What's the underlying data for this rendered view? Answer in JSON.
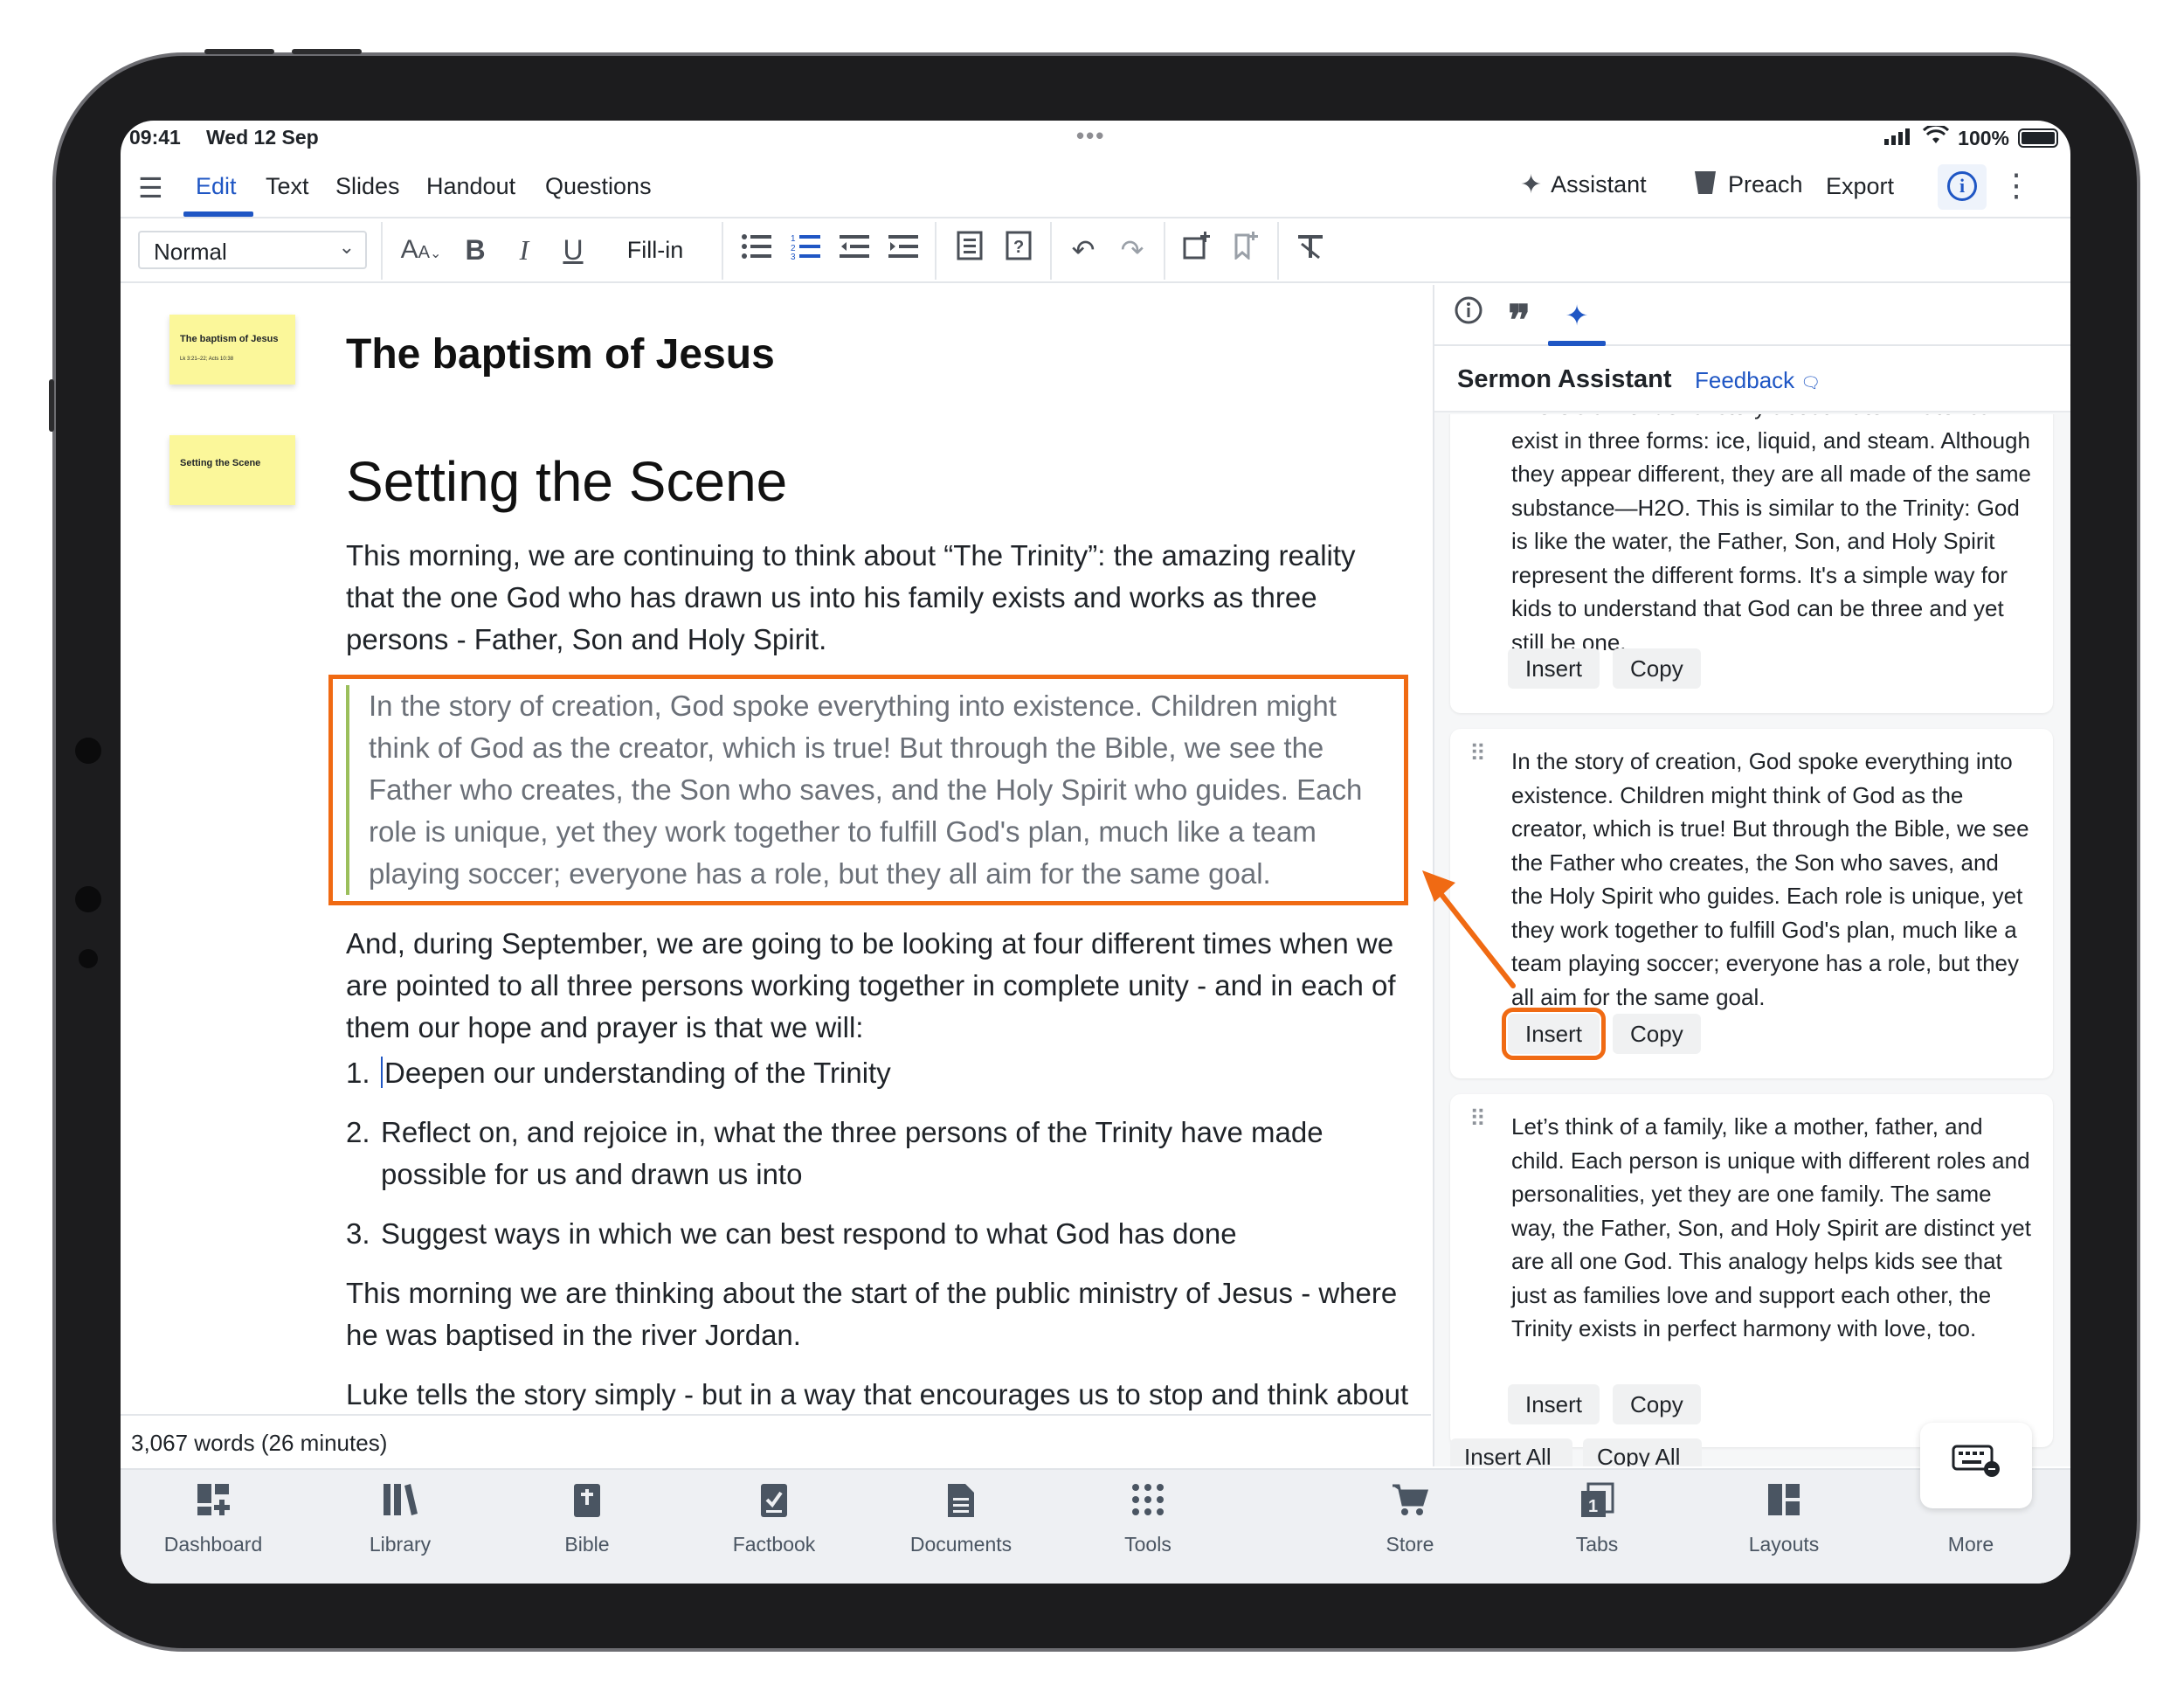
{
  "status": {
    "time": "09:41",
    "date": "Wed 12 Sep",
    "battery": "100%"
  },
  "menu": {
    "tabs": [
      "Edit",
      "Text",
      "Slides",
      "Handout",
      "Questions"
    ],
    "active_tab": "Edit",
    "assistant": "Assistant",
    "preach": "Preach",
    "export": "Export"
  },
  "toolbar": {
    "paragraph_style": "Normal",
    "fill_in": "Fill-in"
  },
  "slides": [
    {
      "title": "The baptism of Jesus",
      "subtitle": "Lk 3:21–22; Acts 10:38"
    },
    {
      "title": "Setting the Scene",
      "subtitle": ""
    }
  ],
  "document": {
    "title": "The baptism of Jesus",
    "heading": "Setting the Scene",
    "para1": "This morning, we are continuing to think about “The Trinity”: the amazing reality that the one God who has drawn us into his family exists and works as three persons - Father, Son and Holy Spirit.",
    "quote": "In the story of creation, God spoke everything into existence. Children might think of God as the creator, which is true! But through the Bible, we see the Father who creates, the Son who saves, and the Holy Spirit who guides. Each role is unique, yet they work together to fulfill God's plan, much like a team playing soccer; everyone has a role, but they all aim for the same goal.",
    "para2": "And, during September, we are going to be looking at four different times when we are pointed to all three persons working together in complete unity - and in each of them our hope and prayer is that we will:",
    "list": [
      {
        "num": "1.",
        "text": "Deepen our understanding of the Trinity"
      },
      {
        "num": "2.",
        "text": "Reflect on, and rejoice in, what the three persons of the Trinity have made possible for us and drawn us into"
      },
      {
        "num": "3.",
        "text": "Suggest ways in which we can best respond to what God has done"
      }
    ],
    "para3": "This morning we are thinking about the start of the public ministry of Jesus - where he was  baptised in the river Jordan.",
    "para4": "Luke tells the story simply - but in a way that encourages us to stop and think about what is happening and how we should respond.",
    "word_count": "3,067 words (26 minutes)"
  },
  "assistant": {
    "title": "Sermon Assistant",
    "feedback": "Feedback",
    "cards": [
      {
        "text": "There's a wonderful story about water. Water can exist in three forms: ice, liquid, and steam. Although they appear different, they are all made of the same substance—H2O. This is similar to the Trinity: God is like the water, the Father, Son, and Holy Spirit represent the different forms. It's a simple way for kids to understand that God can be three and yet still be one.",
        "insert": "Insert",
        "copy": "Copy"
      },
      {
        "text": "In the story of creation, God spoke everything into existence. Children might think of God as the creator, which is true! But through the Bible, we see the Father who creates, the Son who saves, and the Holy Spirit who guides. Each role is unique, yet they work together to fulfill God's plan, much like a team playing soccer; everyone has a role, but they all aim for the same goal.",
        "insert": "Insert",
        "copy": "Copy"
      },
      {
        "text": "Let’s think of a family, like a mother, father, and child. Each person is unique with different roles and personalities, yet they are one family. The same way, the Father, Son, and Holy Spirit are distinct yet are all one God. This analogy helps kids see that just as families love and support each other, the Trinity exists in perfect harmony with love, too.",
        "insert": "Insert",
        "copy": "Copy"
      }
    ],
    "insert_all": "Insert All",
    "copy_all": "Copy All"
  },
  "bottom_tabs": [
    "Dashboard",
    "Library",
    "Bible",
    "Factbook",
    "Documents",
    "Tools",
    "Store",
    "Tabs",
    "Layouts",
    "More"
  ],
  "colors": {
    "accent": "#1f56c4",
    "highlight": "#f06a13",
    "sticky": "#fbf79a"
  }
}
